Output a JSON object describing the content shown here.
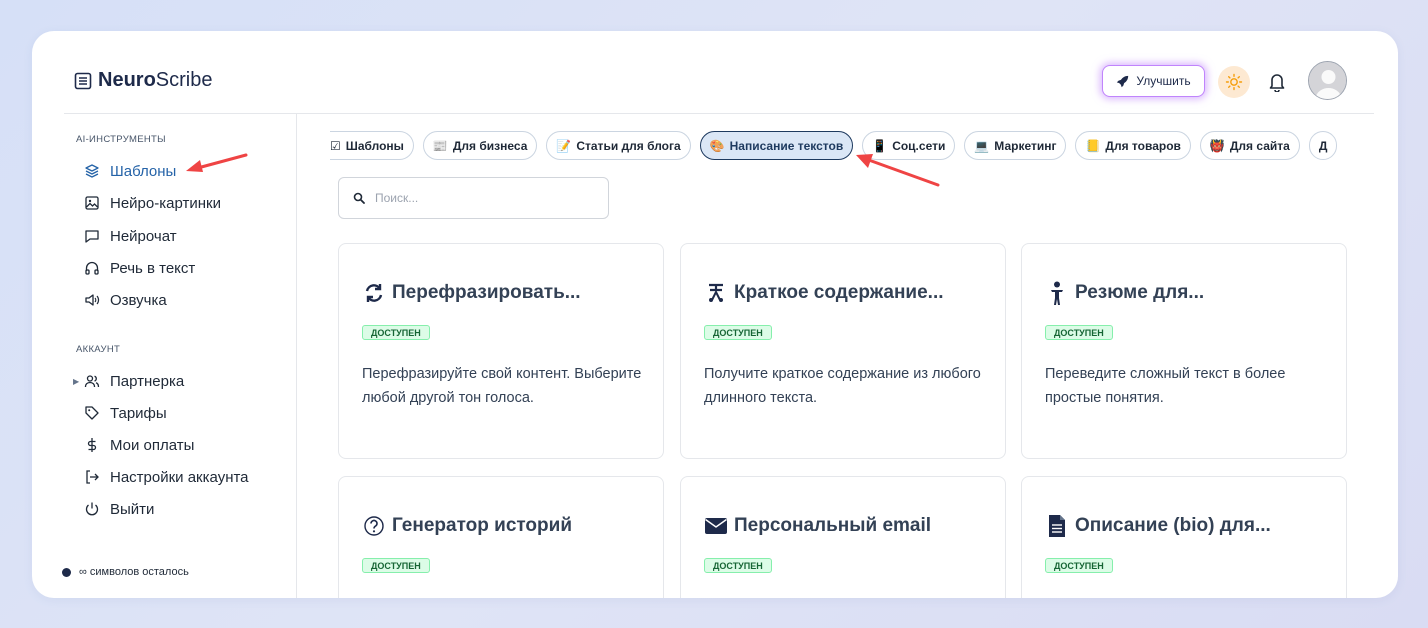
{
  "header": {
    "logo_bold": "Neuro",
    "logo_light": "Scribe",
    "upgrade_label": "Улучшить"
  },
  "sidebar": {
    "section_ai": "AI-ИНСТРУМЕНТЫ",
    "ai_items": [
      {
        "label": "Шаблоны",
        "icon": "layers-icon",
        "active": true
      },
      {
        "label": "Нейро-картинки",
        "icon": "image-icon"
      },
      {
        "label": "Нейрочат",
        "icon": "chat-icon"
      },
      {
        "label": "Речь в текст",
        "icon": "headphones-icon"
      },
      {
        "label": "Озвучка",
        "icon": "speaker-icon"
      }
    ],
    "section_account": "АККАУНТ",
    "account_items": [
      {
        "label": "Партнерка",
        "icon": "users-icon"
      },
      {
        "label": "Тарифы",
        "icon": "tag-icon"
      },
      {
        "label": "Мои оплаты",
        "icon": "dollar-icon"
      },
      {
        "label": "Настройки аккаунта",
        "icon": "logout-arrow-icon"
      },
      {
        "label": "Выйти",
        "icon": "power-icon"
      }
    ],
    "credits_text": "∞ символов осталось"
  },
  "chips": [
    {
      "emoji": "☑",
      "label": "Шаблоны"
    },
    {
      "emoji": "📰",
      "label": "Для бизнеса"
    },
    {
      "emoji": "📝",
      "label": "Статьи для блога"
    },
    {
      "emoji": "🎨",
      "label": "Написание текстов",
      "active": true
    },
    {
      "emoji": "📱",
      "label": "Соц.сети"
    },
    {
      "emoji": "💻",
      "label": "Маркетинг"
    },
    {
      "emoji": "📒",
      "label": "Для товаров"
    },
    {
      "emoji": "👹",
      "label": "Для сайта"
    },
    {
      "emoji": "",
      "label": "Д"
    }
  ],
  "search": {
    "placeholder": "Поиск..."
  },
  "cards": [
    {
      "title": "Перефразировать...",
      "icon": "refresh-icon",
      "badge": "ДОСТУПЕН",
      "desc": "Перефразируйте свой контент. Выберите любой другой тон голоса."
    },
    {
      "title": "Краткое содержание...",
      "icon": "text-summary-icon",
      "badge": "ДОСТУПЕН",
      "desc": "Получите краткое содержание из любого длинного текста."
    },
    {
      "title": "Резюме для...",
      "icon": "child-icon",
      "badge": "ДОСТУПЕН",
      "desc": "Переведите сложный текст в более простые понятия."
    },
    {
      "title": "Генератор историй",
      "icon": "question-circle-icon",
      "badge": "ДОСТУПЕН",
      "desc": ""
    },
    {
      "title": "Персональный email",
      "icon": "envelope-icon",
      "badge": "ДОСТУПЕН",
      "desc": ""
    },
    {
      "title": "Описание (bio) для...",
      "icon": "file-icon",
      "badge": "ДОСТУПЕН",
      "desc": ""
    }
  ],
  "colors": {
    "accent": "#2563a8",
    "badge_bg": "#dcfce7",
    "arrow": "#ef4444",
    "upgrade_glow": "#c084fc"
  }
}
